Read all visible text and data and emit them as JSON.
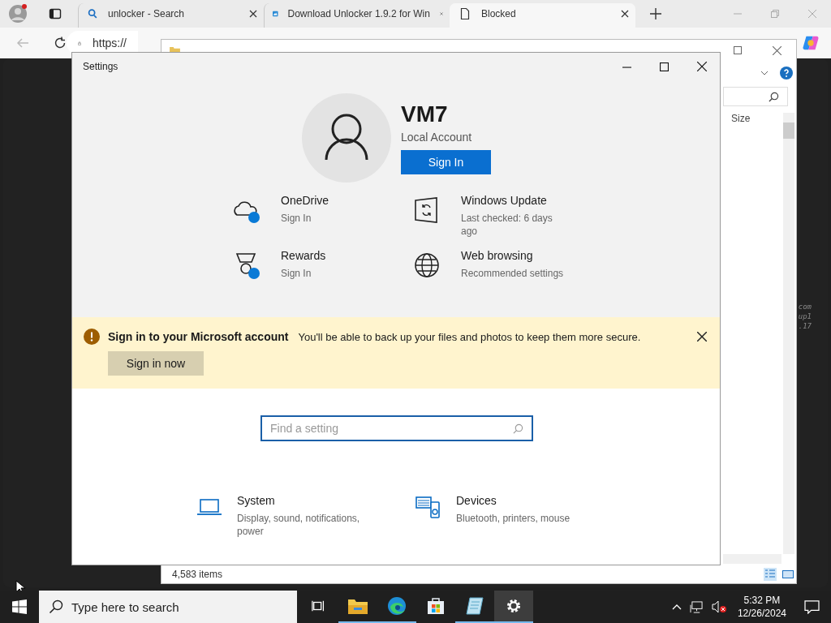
{
  "browser": {
    "tabs": [
      {
        "title": "unlocker - Search",
        "selected": false
      },
      {
        "title": "Download Unlocker 1.9.2 for Win",
        "selected": false
      },
      {
        "title": "Blocked",
        "selected": true
      }
    ],
    "address": "https://"
  },
  "console_fragments": [
    "com",
    "up1",
    ".17"
  ],
  "explorer": {
    "column": "Size",
    "status": "4,583 items"
  },
  "settings": {
    "title": "Settings",
    "account": {
      "name": "VM7",
      "type": "Local Account",
      "button": "Sign In"
    },
    "tiles": [
      {
        "title": "OneDrive",
        "subtitle": "Sign In"
      },
      {
        "title": "Windows Update",
        "subtitle": "Last checked: 6 days ago"
      },
      {
        "title": "Rewards",
        "subtitle": "Sign In"
      },
      {
        "title": "Web browsing",
        "subtitle": "Recommended settings"
      }
    ],
    "banner": {
      "title": "Sign in to your Microsoft account",
      "message": "You'll be able to back up your files and photos to keep them more secure.",
      "button": "Sign in now"
    },
    "search": {
      "placeholder": "Find a setting"
    },
    "categories": [
      {
        "title": "System",
        "subtitle": "Display, sound, notifications, power"
      },
      {
        "title": "Devices",
        "subtitle": "Bluetooth, printers, mouse"
      }
    ]
  },
  "taskbar": {
    "search_placeholder": "Type here to search",
    "apps": [
      {
        "running": false,
        "selected": false
      },
      {
        "running": true,
        "selected": false
      },
      {
        "running": true,
        "selected": false
      },
      {
        "running": false,
        "selected": false
      },
      {
        "running": true,
        "selected": false
      },
      {
        "running": true,
        "selected": true
      }
    ],
    "time": "5:32 PM",
    "date": "12/26/2024"
  }
}
